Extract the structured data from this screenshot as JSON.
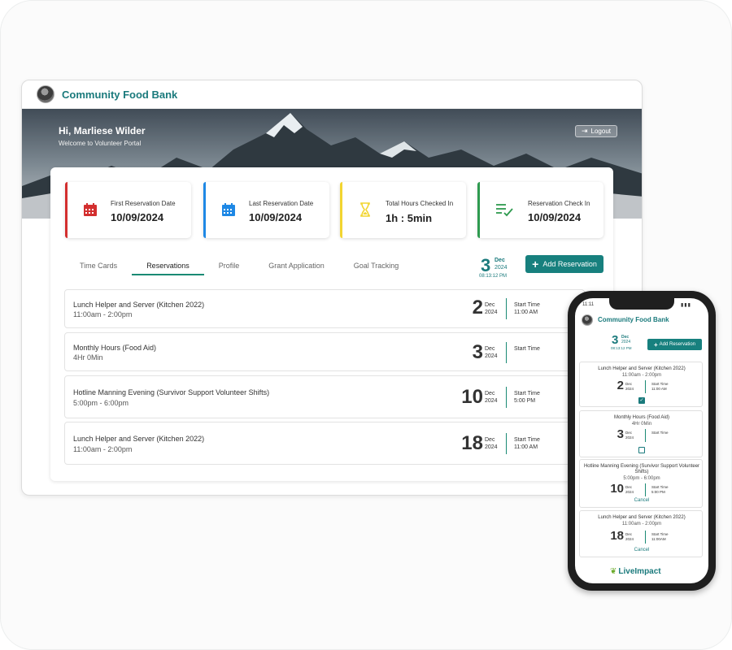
{
  "app": {
    "title": "Community Food Bank"
  },
  "hero": {
    "greeting": "Hi, Marliese Wilder",
    "subtitle": "Welcome to Volunteer Portal",
    "logout_label": "Logout"
  },
  "stats": [
    {
      "label": "First Reservation Date",
      "value": "10/09/2024",
      "icon": "calendar-icon",
      "color": "#d32f2f"
    },
    {
      "label": "Last Reservation Date",
      "value": "10/09/2024",
      "icon": "calendar-icon",
      "color": "#1e88e5"
    },
    {
      "label": "Total Hours Checked In",
      "value": "1h : 5min",
      "icon": "hourglass-icon",
      "color": "#f2d531"
    },
    {
      "label": "Reservation Check In",
      "value": "10/09/2024",
      "icon": "checklist-icon",
      "color": "#2e9a4f"
    }
  ],
  "tabs": [
    "Time Cards",
    "Reservations",
    "Profile",
    "Grant Application",
    "Goal Tracking"
  ],
  "active_tab": "Reservations",
  "today": {
    "day": "3",
    "month": "Dec",
    "year": "2024",
    "time": "08:13:12 PM"
  },
  "add_reservation_label": "Add Reservation",
  "reservations": [
    {
      "title": "Lunch Helper and Server (Kitchen 2022)",
      "subtitle": "11:00am - 2:00pm",
      "day": "2",
      "month": "Dec",
      "year": "2024",
      "start_label": "Start Time",
      "start_value": "11:00 AM"
    },
    {
      "title": "Monthly Hours (Food Aid)",
      "subtitle": "4Hr 0Min",
      "day": "3",
      "month": "Dec",
      "year": "2024",
      "start_label": "Start Time",
      "start_value": ""
    },
    {
      "title": "Hotline Manning Evening (Survivor Support Volunteer Shifts)",
      "subtitle": "5:00pm - 6:00pm",
      "day": "10",
      "month": "Dec",
      "year": "2024",
      "start_label": "Start Time",
      "start_value": "5:00 PM"
    },
    {
      "title": "Lunch Helper and Server (Kitchen 2022)",
      "subtitle": "11:00am - 2:00pm",
      "day": "18",
      "month": "Dec",
      "year": "2024",
      "start_label": "Start Time",
      "start_value": "11:00 AM"
    }
  ],
  "phone": {
    "status_time": "11:11",
    "status_icons": "▮▮▮",
    "title": "Community Food Bank",
    "add_reservation_label": "Add Reservation",
    "cancel_label": "Cancel",
    "logo_name": "LiveImpact",
    "reservations": [
      {
        "title": "Lunch Helper and Server (Kitchen 2022)",
        "subtitle": "11:00am - 2:00pm",
        "day": "2",
        "month": "Dec",
        "year": "2024",
        "start_label": "Start Time",
        "start_value": "11:00 AM",
        "checked": true
      },
      {
        "title": "Monthly Hours (Food Aid)",
        "subtitle": "4Hr 0Min",
        "day": "3",
        "month": "Dec",
        "year": "2024",
        "start_label": "Start Time",
        "start_value": "",
        "checked": false
      },
      {
        "title": "Hotline Manning Evening (Survivor Support Volunteer Shifts)",
        "subtitle": "5:00pm - 6:00pm",
        "day": "10",
        "month": "Dec",
        "year": "2024",
        "start_label": "Start Time",
        "start_value": "5:00 PM",
        "cancel": true
      },
      {
        "title": "Lunch Helper and Server (Kitchen 2022)",
        "subtitle": "11:00am - 2:00pm",
        "day": "18",
        "month": "Dec",
        "year": "2024",
        "start_label": "Start Time",
        "start_value": "11:00AM",
        "cancel": true
      }
    ]
  },
  "colors": {
    "brand": "#1a7a7c",
    "button": "#17807e",
    "tab_underline": "#1a8a74"
  }
}
